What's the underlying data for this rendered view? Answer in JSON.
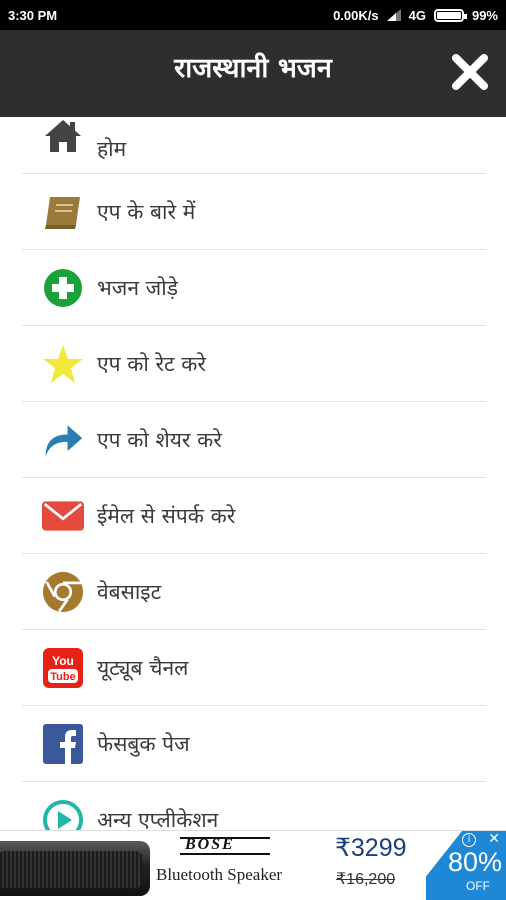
{
  "status": {
    "time": "3:30 PM",
    "speed": "0.00K/s",
    "network": "4G",
    "battery": "99%",
    "battery_level": 0.99
  },
  "header": {
    "title": "राजस्थानी भजन"
  },
  "menu": {
    "items": [
      {
        "label": "होम",
        "icon": "home-icon"
      },
      {
        "label": "एप के बारे में",
        "icon": "book-icon"
      },
      {
        "label": "भजन जोड़े",
        "icon": "plus-circle-icon"
      },
      {
        "label": "एप को रेट करे",
        "icon": "star-icon"
      },
      {
        "label": "एप को शेयर करे",
        "icon": "share-arrow-icon"
      },
      {
        "label": "ईमेल से संपर्क करे",
        "icon": "mail-icon"
      },
      {
        "label": "वेबसाइट",
        "icon": "chrome-icon"
      },
      {
        "label": "यूट्यूब चैनल",
        "icon": "youtube-icon"
      },
      {
        "label": "फेसबुक पेज",
        "icon": "facebook-icon"
      },
      {
        "label": "अन्य एप्लीकेशन",
        "icon": "play-circle-icon"
      }
    ]
  },
  "ad": {
    "brand": "BOSE",
    "product": "Bluetooth Speaker",
    "price": "₹3299",
    "old_price": "₹16,200",
    "discount": "80%",
    "discount_label": "OFF"
  },
  "colors": {
    "header_bg": "#2f2e2c",
    "home": "#444444",
    "book": "#9a7a3a",
    "plus": "#1aa13a",
    "star": "#f1e83a",
    "share": "#2a7fb0",
    "mail": "#e54a3c",
    "chrome": "#a57a2e",
    "youtube": "#e62117",
    "facebook": "#3b5998",
    "play": "#21b6a8"
  }
}
